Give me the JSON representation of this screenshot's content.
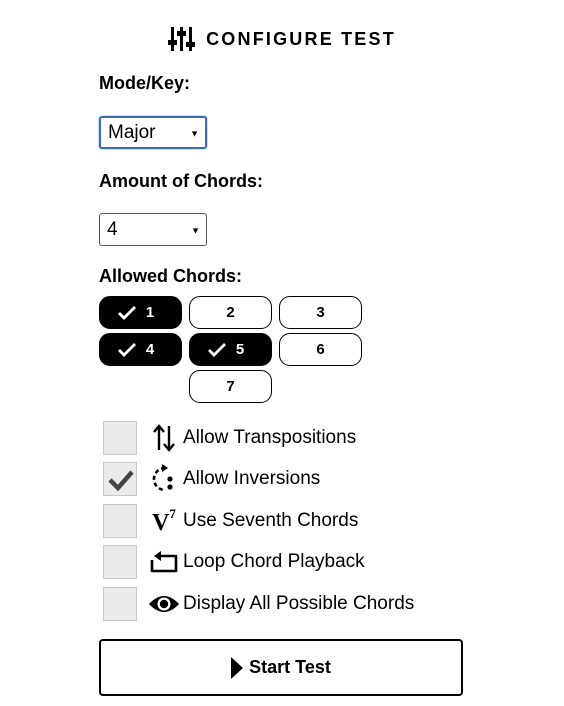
{
  "header": {
    "icon": "sliders-icon",
    "title": "CONFIGURE TEST"
  },
  "mode": {
    "label": "Mode/Key:",
    "selected": "Major"
  },
  "amount": {
    "label": "Amount of Chords:",
    "selected": "4"
  },
  "allowed": {
    "label": "Allowed Chords:",
    "chords": [
      {
        "label": "1",
        "selected": true
      },
      {
        "label": "2",
        "selected": false
      },
      {
        "label": "3",
        "selected": false
      },
      {
        "label": "4",
        "selected": true
      },
      {
        "label": "5",
        "selected": true
      },
      {
        "label": "6",
        "selected": false
      },
      {
        "label": "7",
        "selected": false
      }
    ]
  },
  "options": [
    {
      "label": "Allow Transpositions",
      "checked": false,
      "icon": "transpose-arrows-icon"
    },
    {
      "label": "Allow Inversions",
      "checked": true,
      "icon": "inversion-icon"
    },
    {
      "label": "Use Seventh Chords",
      "checked": false,
      "icon": "seventh-chord-icon",
      "icon_text": "V",
      "icon_sup": "7"
    },
    {
      "label": "Loop Chord Playback",
      "checked": false,
      "icon": "loop-icon"
    },
    {
      "label": "Display All Possible Chords",
      "checked": false,
      "icon": "eye-icon"
    }
  ],
  "start": {
    "label": "Start Test",
    "icon": "play-icon"
  }
}
